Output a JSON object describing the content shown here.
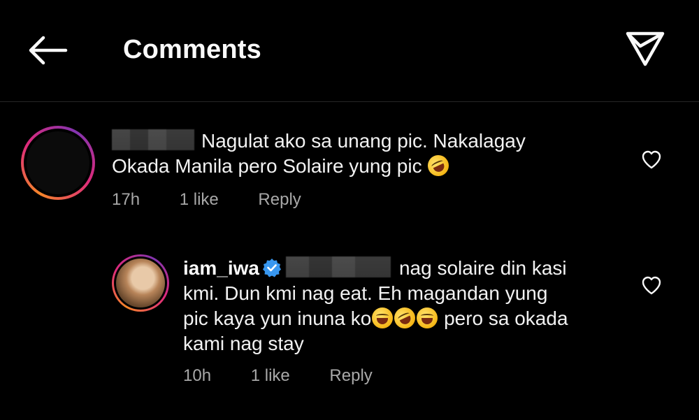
{
  "header": {
    "title": "Comments",
    "back_icon": "arrow-left-icon",
    "send_icon": "send-icon"
  },
  "comments": [
    {
      "username": "",
      "text_line1": "Nagulat ako sa unang pic. Nakalagay",
      "text_line2": "Okada Manila pero Solaire yung pic",
      "emoji": "rofl-emoji",
      "time": "17h",
      "likes": "1 like",
      "reply": "Reply"
    },
    {
      "username": "iam_iwa",
      "verified": true,
      "text_line1": "nag solaire din kasi",
      "text_line2": "kmi. Dun kmi nag eat. Eh magandan yung",
      "text_line3a": "pic kaya yun inuna ko",
      "text_line3b": "pero sa okada",
      "text_line4": "kami nag stay",
      "emojis": [
        "grinning-sweat-emoji",
        "rofl-emoji",
        "grinning-sweat-emoji"
      ],
      "time": "10h",
      "likes": "1 like",
      "reply": "Reply"
    }
  ],
  "colors": {
    "background": "#000000",
    "text": "#f2f2f2",
    "meta": "#a8a8a8",
    "verified": "#3897f0"
  }
}
